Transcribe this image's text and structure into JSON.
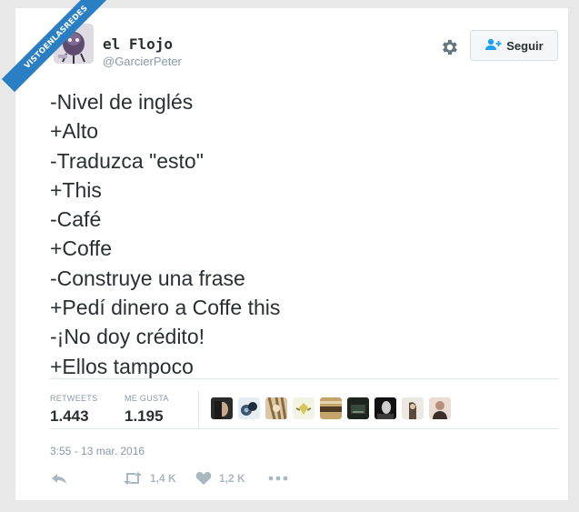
{
  "watermark": "VISTOENLASREDES",
  "author": {
    "name": "el Flojo",
    "handle": "@GarcierPeter"
  },
  "follow_button": {
    "label": "Seguir",
    "icon": "add-user-icon"
  },
  "settings_icon": "gear-icon",
  "tweet_lines": [
    "-Nivel de inglés",
    "+Alto",
    "-Traduzca \"esto\"",
    "+This",
    "-Café",
    "+Coffe",
    "-Construye una frase",
    "+Pedí dinero a Coffe this",
    "-¡No doy crédito!",
    "+Ellos tampoco"
  ],
  "stats": {
    "retweets_label": "RETWEETS",
    "retweets_value": "1.443",
    "likes_label": "ME GUSTA",
    "likes_value": "1.195"
  },
  "likers_count": 9,
  "timestamp": "3:55 - 13 mar. 2016",
  "actions": {
    "reply_icon": "reply-icon",
    "retweet_icon": "retweet-icon",
    "retweet_count": "1,4 K",
    "like_icon": "heart-icon",
    "like_count": "1,2 K",
    "more_icon": "more-icon"
  },
  "colors": {
    "watermark_bg": "#2a7ec4",
    "text": "#292f33",
    "muted": "#8899a6",
    "action_gray": "#aab8c2",
    "follow_icon": "#1da1f2"
  }
}
